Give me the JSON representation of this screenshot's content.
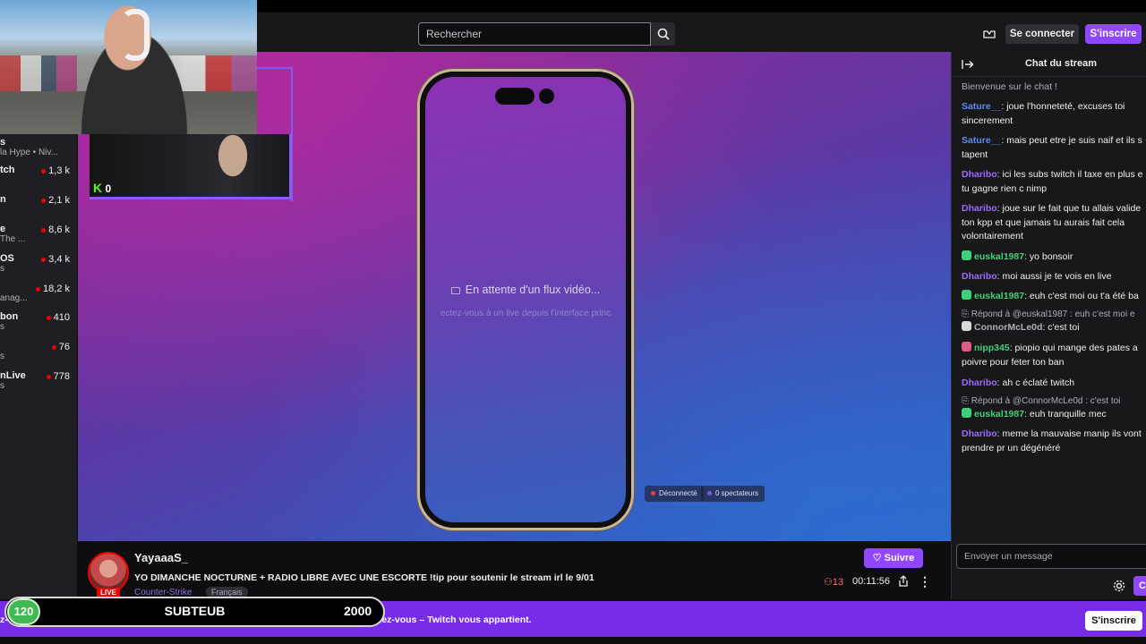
{
  "navbar": {
    "search_placeholder": "Rechercher",
    "login_label": "Se connecter",
    "signup_label": "S'inscrire"
  },
  "sidebar": {
    "items": [
      {
        "name": "s",
        "sub": "la Hype • Niv...",
        "count": ""
      },
      {
        "name": "tch",
        "sub": "",
        "count": "1,3 k"
      },
      {
        "name": "n",
        "sub": "",
        "count": "2,1 k"
      },
      {
        "name": "e",
        "sub": "The ...",
        "count": "8,6 k"
      },
      {
        "name": "OS",
        "sub": "s",
        "count": "3,4 k"
      },
      {
        "name": "",
        "sub": "anag...",
        "count": "18,2 k"
      },
      {
        "name": "bon",
        "sub": "s",
        "count": "410"
      },
      {
        "name": "",
        "sub": "s",
        "count": "76"
      },
      {
        "name": "nLive",
        "sub": "s",
        "count": "778"
      }
    ]
  },
  "overlay": {
    "kick_count": "0"
  },
  "player": {
    "waiting_text": "En attente d'un flux vidéo...",
    "waiting_subtext": "ectez-vous à un live depuis l'interface princ",
    "status_disconnected": "Déconnecté",
    "spectators": "0 spectateurs"
  },
  "stream": {
    "streamer": "YayaaaS_",
    "live_label": "LIVE",
    "title": "YO DIMANCHE NOCTURNE + RADIO LIBRE AVEC UNE ESCORTE !tip pour soutenir le stream irl le 9/01",
    "category": "Counter-Strike",
    "tag": "Français",
    "follow_label": "Suivre",
    "viewers": "13",
    "uptime": "00:11:56"
  },
  "chat": {
    "title": "Chat du stream",
    "welcome": "Bienvenue sur le chat !",
    "messages": [
      {
        "user": "Sature__",
        "text": ": joue l'honneteté, excuses toi",
        "cont": "sincerement",
        "color": "#5b8def"
      },
      {
        "user": "Sature__",
        "text": ": mais peut etre je suis naif et ils s",
        "cont": "tapent",
        "color": "#5b8def"
      },
      {
        "user": "Dharibo",
        "text": ": ici les subs twitch il taxe en plus e",
        "cont": "tu gagne rien c nimp",
        "color": "#9b6bff"
      },
      {
        "user": "Dharibo",
        "text": ": joue sur le fait que tu allais valide",
        "cont": "ton kpp et que jamais tu aurais fait cela",
        "cont2": "volontairement",
        "color": "#9b6bff"
      },
      {
        "user": "euskal1987",
        "text": ": yo bonsoir",
        "color": "#3fd17a"
      },
      {
        "user": "Dharibo",
        "text": ": moi aussi je te vois en live",
        "color": "#9b6bff"
      },
      {
        "user": "euskal1987",
        "text": ": euh c'est moi ou t'a été ba",
        "color": "#3fd17a"
      },
      {
        "user": "ConnorMcLe0d",
        "text": ": c'est toi",
        "color": "#adadb8",
        "reply": "Répond à @euskal1987 : euh c'est moi e"
      },
      {
        "user": "nipp345",
        "text": ": piopio qui mange des pates a",
        "cont": "poivre pour feter ton ban",
        "color": "#3fd17a"
      },
      {
        "user": "Dharibo",
        "text": ": ah c éclaté twitch",
        "color": "#9b6bff"
      },
      {
        "user": "euskal1987",
        "text": ": euh tranquille mec",
        "color": "#3fd17a",
        "reply": "Répond à @ConnorMcLe0d : c'est toi"
      },
      {
        "user": "Dharibo",
        "text": ": meme la mauvaise manip ils vont",
        "cont": "prendre pr un dégénéré",
        "color": "#9b6bff"
      }
    ],
    "input_placeholder": "Envoyer un message",
    "send_label": "C"
  },
  "banner": {
    "text": "z-vous pour profiter de ce que YayaaaS_ a de mieux à offrir. Chattez, suivez ou abonnez-vous – Twitch vous appartient.",
    "button": "S'inscrire"
  },
  "sub_goal": {
    "current": "120",
    "label": "SUBTEUB",
    "target": "2000"
  },
  "colors": {
    "accent": "#9147ff",
    "live": "#eb0400",
    "banner": "#772ce8"
  }
}
